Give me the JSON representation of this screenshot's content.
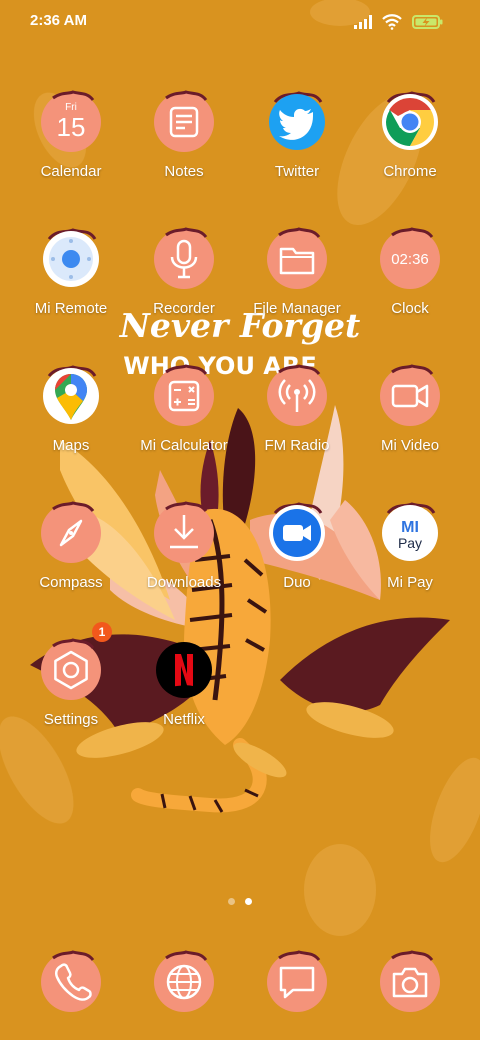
{
  "status_bar": {
    "time": "2:36 AM",
    "icons": [
      "signal-icon",
      "wifi-icon",
      "battery-charging-icon"
    ]
  },
  "wallpaper": {
    "line1": "Never Forget",
    "line2": "WHO YOU ARE",
    "background_color": "#d9931f"
  },
  "calendar_icon": {
    "day": "Fri",
    "date": "15"
  },
  "clock_icon": {
    "time": "02:36"
  },
  "mipay_icon": {
    "line1": "MI",
    "line2": "Pay"
  },
  "apps": [
    {
      "label": "Calendar",
      "icon": "calendar-icon"
    },
    {
      "label": "Notes",
      "icon": "notes-icon"
    },
    {
      "label": "Twitter",
      "icon": "twitter-icon"
    },
    {
      "label": "Chrome",
      "icon": "chrome-icon"
    },
    {
      "label": "Mi Remote",
      "icon": "remote-icon"
    },
    {
      "label": "Recorder",
      "icon": "microphone-icon"
    },
    {
      "label": "File Manager",
      "icon": "folder-icon"
    },
    {
      "label": "Clock",
      "icon": "clock-icon"
    },
    {
      "label": "Maps",
      "icon": "maps-pin-icon"
    },
    {
      "label": "Mi Calculator",
      "icon": "calculator-icon"
    },
    {
      "label": "FM Radio",
      "icon": "radio-icon"
    },
    {
      "label": "Mi Video",
      "icon": "video-icon"
    },
    {
      "label": "Compass",
      "icon": "compass-icon"
    },
    {
      "label": "Downloads",
      "icon": "download-icon"
    },
    {
      "label": "Duo",
      "icon": "duo-video-icon"
    },
    {
      "label": "Mi Pay",
      "icon": "mi-pay-icon"
    },
    {
      "label": "Settings",
      "icon": "settings-icon"
    },
    {
      "label": "Netflix",
      "icon": "netflix-icon"
    }
  ],
  "settings_badge": "1",
  "page_indicator": {
    "total": 2,
    "active": 2
  },
  "dock": [
    {
      "icon": "phone-icon"
    },
    {
      "icon": "browser-globe-icon"
    },
    {
      "icon": "messages-icon"
    },
    {
      "icon": "camera-icon"
    }
  ],
  "colors": {
    "blob": "#f4937a",
    "blob_dark": "#6b1c2a",
    "badge": "#f2581c"
  }
}
